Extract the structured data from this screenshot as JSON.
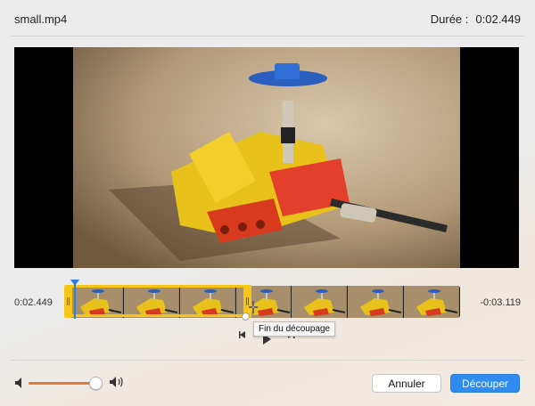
{
  "header": {
    "filename": "small.mp4",
    "duration_label": "Durée :",
    "duration_value": "0:02.449"
  },
  "timeline": {
    "elapsed": "0:02.449",
    "remaining": "-0:03.119",
    "trim_tooltip": "Fin du découpage",
    "thumbnail_count": 7
  },
  "volume": {
    "level": 0.92
  },
  "buttons": {
    "cancel_label": "Annuler",
    "trim_label": "Découper"
  },
  "colors": {
    "accent": "#2f8bf0",
    "trim_handle": "#f5c518",
    "volume_fill": "#e07b3a"
  }
}
